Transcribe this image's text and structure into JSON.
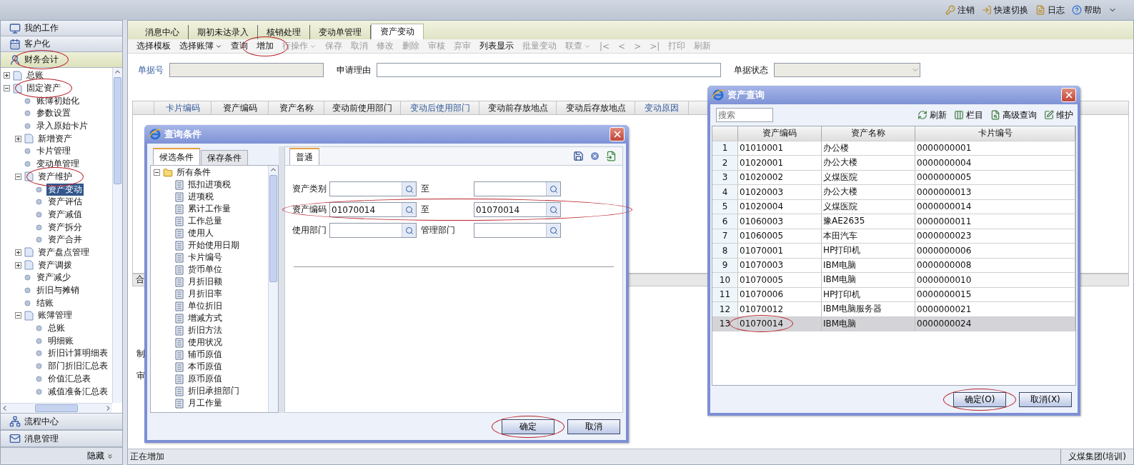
{
  "header": {
    "links": [
      {
        "label": "注销"
      },
      {
        "label": "快速切换"
      },
      {
        "label": "日志"
      },
      {
        "label": "帮助"
      }
    ]
  },
  "sidebar": {
    "sections": [
      {
        "label": "我的工作",
        "selected": false,
        "circled": false
      },
      {
        "label": "客户化",
        "selected": false,
        "circled": false
      },
      {
        "label": "财务会计",
        "selected": true,
        "circled": true
      }
    ],
    "tree": [
      {
        "label": "总账",
        "expanded": false,
        "selected": false,
        "circled": false
      },
      {
        "label": "固定资产",
        "expanded": true,
        "selected": false,
        "circled": true,
        "children": [
          {
            "label": "账簿初始化",
            "selected": false,
            "circled": false
          },
          {
            "label": "参数设置",
            "selected": false,
            "circled": false
          },
          {
            "label": "录入原始卡片",
            "selected": false,
            "circled": false
          },
          {
            "label": "新增资产",
            "expanded": false,
            "selected": false,
            "circled": false
          },
          {
            "label": "卡片管理",
            "selected": false,
            "circled": false
          },
          {
            "label": "变动单管理",
            "selected": false,
            "circled": false
          },
          {
            "label": "资产维护",
            "expanded": true,
            "selected": false,
            "circled": true,
            "children": [
              {
                "label": "资产变动",
                "selected": true,
                "circled": false
              },
              {
                "label": "资产评估",
                "selected": false,
                "circled": false
              },
              {
                "label": "资产减值",
                "selected": false,
                "circled": false
              },
              {
                "label": "资产拆分",
                "selected": false,
                "circled": false
              },
              {
                "label": "资产合并",
                "selected": false,
                "circled": false
              }
            ]
          },
          {
            "label": "资产盘点管理",
            "expanded": false,
            "selected": false,
            "circled": false
          },
          {
            "label": "资产调拨",
            "expanded": false,
            "selected": false,
            "circled": false
          },
          {
            "label": "资产减少",
            "selected": false,
            "circled": false
          },
          {
            "label": "折旧与摊销",
            "selected": false,
            "circled": false
          },
          {
            "label": "结账",
            "selected": false,
            "circled": false
          },
          {
            "label": "账簿管理",
            "expanded": true,
            "selected": false,
            "circled": false,
            "children": [
              {
                "label": "总账",
                "selected": false,
                "circled": false
              },
              {
                "label": "明细账",
                "selected": false,
                "circled": false
              },
              {
                "label": "折旧计算明细表",
                "selected": false,
                "circled": false
              },
              {
                "label": "部门折旧汇总表",
                "selected": false,
                "circled": false
              },
              {
                "label": "价值汇总表",
                "selected": false,
                "circled": false
              },
              {
                "label": "减值准备汇总表",
                "selected": false,
                "circled": false
              }
            ]
          }
        ]
      }
    ],
    "bottom_sections": [
      {
        "label": "流程中心"
      },
      {
        "label": "消息管理"
      }
    ],
    "hide_button": "隐藏"
  },
  "tabs": [
    {
      "label": "消息中心",
      "selected": false
    },
    {
      "label": "期初未达录入",
      "selected": false
    },
    {
      "label": "核销处理",
      "selected": false
    },
    {
      "label": "变动单管理",
      "selected": false
    },
    {
      "label": "资产变动",
      "selected": true
    }
  ],
  "toolbar": [
    {
      "label": "选择模板",
      "disabled": false,
      "dropdown": false,
      "circled": false
    },
    {
      "label": "选择账簿",
      "disabled": false,
      "dropdown": true,
      "circled": false
    },
    {
      "label": "查询",
      "disabled": false,
      "dropdown": false,
      "circled": false
    },
    {
      "label": "增加",
      "disabled": false,
      "dropdown": false,
      "circled": true
    },
    {
      "label": "行操作",
      "disabled": true,
      "dropdown": true,
      "circled": false
    },
    {
      "label": "保存",
      "disabled": true,
      "dropdown": false,
      "circled": false
    },
    {
      "label": "取消",
      "disabled": true,
      "dropdown": false,
      "circled": false
    },
    {
      "label": "修改",
      "disabled": true,
      "dropdown": false,
      "circled": false
    },
    {
      "label": "删除",
      "disabled": true,
      "dropdown": false,
      "circled": false
    },
    {
      "label": "审核",
      "disabled": true,
      "dropdown": false,
      "circled": false
    },
    {
      "label": "弃审",
      "disabled": true,
      "dropdown": false,
      "circled": false
    },
    {
      "label": "列表显示",
      "disabled": false,
      "dropdown": false,
      "circled": false
    },
    {
      "label": "批量变动",
      "disabled": true,
      "dropdown": false,
      "circled": false
    },
    {
      "label": "联查",
      "disabled": true,
      "dropdown": true,
      "circled": false
    },
    {
      "label": "|<",
      "disabled": true,
      "dropdown": false,
      "circled": false
    },
    {
      "label": "<",
      "disabled": true,
      "dropdown": false,
      "circled": false
    },
    {
      "label": ">",
      "disabled": true,
      "dropdown": false,
      "circled": false
    },
    {
      "label": ">|",
      "disabled": true,
      "dropdown": false,
      "circled": false
    },
    {
      "label": "打印",
      "disabled": true,
      "dropdown": false,
      "circled": false
    },
    {
      "label": "刷新",
      "disabled": true,
      "dropdown": false,
      "circled": false
    }
  ],
  "form": {
    "fields": [
      {
        "label": "单据号",
        "kind": "readonly"
      },
      {
        "label": "申请理由",
        "kind": "text"
      },
      {
        "label": "单据状态",
        "kind": "select"
      }
    ]
  },
  "table": {
    "columns": [
      {
        "label": "卡片编码",
        "required": true
      },
      {
        "label": "资产编码",
        "required": false
      },
      {
        "label": "资产名称",
        "required": false
      },
      {
        "label": "变动前使用部门",
        "required": false
      },
      {
        "label": "变动后使用部门",
        "required": true
      },
      {
        "label": "变动前存放地点",
        "required": false
      },
      {
        "label": "变动后存放地点",
        "required": false
      },
      {
        "label": "变动原因",
        "required": true
      }
    ],
    "footer_label": "合"
  },
  "bottom_labels": [
    "制",
    "审"
  ],
  "query_dialog": {
    "title": "查询条件",
    "left_tabs": [
      {
        "label": "候选条件",
        "selected": true
      },
      {
        "label": "保存条件",
        "selected": false
      }
    ],
    "tree": [
      {
        "label": "所有条件",
        "expanded": true,
        "selected": false,
        "children": [
          {
            "label": "抵扣进项税",
            "selected": false
          },
          {
            "label": "进项税",
            "selected": false
          },
          {
            "label": "累计工作量",
            "selected": false
          },
          {
            "label": "工作总量",
            "selected": false
          },
          {
            "label": "使用人",
            "selected": false
          },
          {
            "label": "开始使用日期",
            "selected": false
          },
          {
            "label": "卡片编号",
            "selected": false
          },
          {
            "label": "货币单位",
            "selected": false
          },
          {
            "label": "月折旧额",
            "selected": false
          },
          {
            "label": "月折旧率",
            "selected": false
          },
          {
            "label": "单位折旧",
            "selected": false
          },
          {
            "label": "增减方式",
            "selected": false
          },
          {
            "label": "折旧方法",
            "selected": false
          },
          {
            "label": "使用状况",
            "selected": false
          },
          {
            "label": "辅币原值",
            "selected": false
          },
          {
            "label": "本币原值",
            "selected": false
          },
          {
            "label": "原币原值",
            "selected": false
          },
          {
            "label": "折旧承担部门",
            "selected": false
          },
          {
            "label": "月工作量",
            "selected": false
          }
        ]
      }
    ],
    "right_tabs": [
      {
        "label": "普通",
        "selected": true
      }
    ],
    "rows": [
      {
        "circled": false,
        "fields": [
          {
            "label": "资产类别"
          },
          {
            "label": "至"
          }
        ]
      },
      {
        "circled": true,
        "fields": [
          {
            "label": "资产编码",
            "value": "01070014"
          },
          {
            "label": "至",
            "value": "01070014"
          }
        ]
      },
      {
        "circled": false,
        "fields": [
          {
            "label": "使用部门"
          },
          {
            "label": "管理部门"
          }
        ]
      }
    ],
    "buttons": [
      {
        "label": "确定",
        "circled": true
      },
      {
        "label": "取消",
        "circled": false
      }
    ]
  },
  "asset_dialog": {
    "title": "资产查询",
    "search": {
      "placeholder": "搜索"
    },
    "tools": [
      {
        "label": "刷新"
      },
      {
        "label": "栏目"
      },
      {
        "label": "高级查询"
      },
      {
        "label": "维护"
      }
    ],
    "columns": [
      "资产编码",
      "资产名称",
      "卡片编号"
    ],
    "rows": [
      {
        "number": "1",
        "code": "01010001",
        "name": "办公楼",
        "card": "0000000001",
        "selected": false,
        "circled": false
      },
      {
        "number": "2",
        "code": "01020001",
        "name": "办公大楼",
        "card": "0000000004",
        "selected": false,
        "circled": false
      },
      {
        "number": "3",
        "code": "01020002",
        "name": "义煤医院",
        "card": "0000000005",
        "selected": false,
        "circled": false
      },
      {
        "number": "4",
        "code": "01020003",
        "name": "办公大楼",
        "card": "0000000013",
        "selected": false,
        "circled": false
      },
      {
        "number": "5",
        "code": "01020004",
        "name": "义煤医院",
        "card": "0000000014",
        "selected": false,
        "circled": false
      },
      {
        "number": "6",
        "code": "01060003",
        "name": "豫AE2635",
        "card": "0000000011",
        "selected": false,
        "circled": false
      },
      {
        "number": "7",
        "code": "01060005",
        "name": "本田汽车",
        "card": "0000000023",
        "selected": false,
        "circled": false
      },
      {
        "number": "8",
        "code": "01070001",
        "name": "HP打印机",
        "card": "0000000006",
        "selected": false,
        "circled": false
      },
      {
        "number": "9",
        "code": "01070003",
        "name": "IBM电脑",
        "card": "0000000008",
        "selected": false,
        "circled": false
      },
      {
        "number": "10",
        "code": "01070005",
        "name": "IBM电脑",
        "card": "0000000010",
        "selected": false,
        "circled": false
      },
      {
        "number": "11",
        "code": "01070006",
        "name": "HP打印机",
        "card": "0000000015",
        "selected": false,
        "circled": false
      },
      {
        "number": "12",
        "code": "01070012",
        "name": "IBM电脑服务器",
        "card": "0000000021",
        "selected": false,
        "circled": false
      },
      {
        "number": "13",
        "code": "01070014",
        "name": "IBM电脑",
        "card": "0000000024",
        "selected": true,
        "circled": true
      }
    ],
    "buttons": [
      {
        "label": "确定(O)",
        "circled": true
      },
      {
        "label": "取消(X)",
        "circled": false
      }
    ]
  },
  "status_bar": {
    "message": "正在增加",
    "company": "义煤集团(培训)"
  }
}
